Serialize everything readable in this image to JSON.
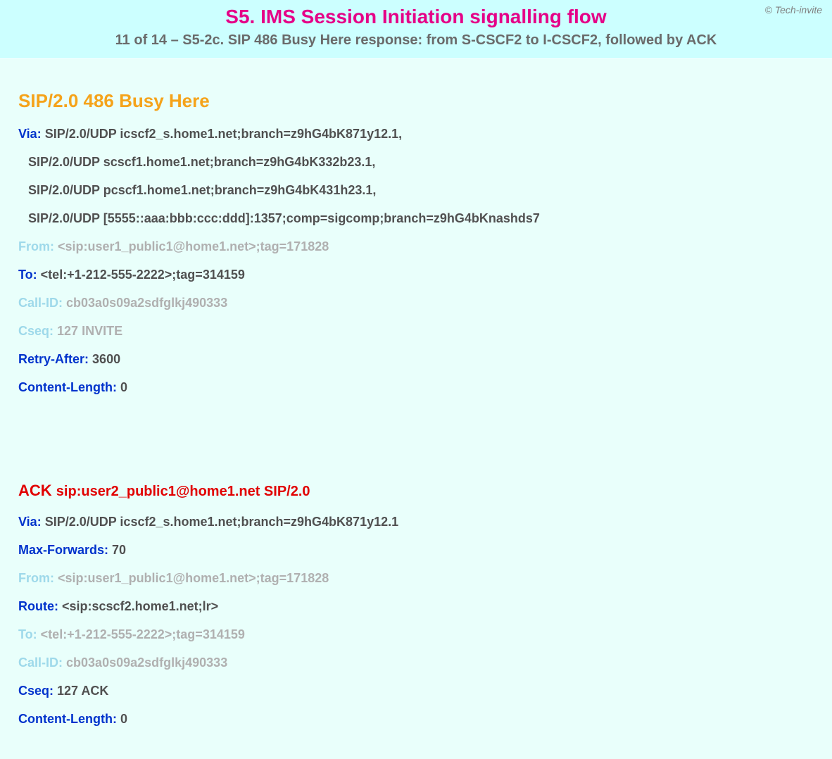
{
  "header": {
    "attribution": "© Tech-invite",
    "title": "S5. IMS Session Initiation signalling flow",
    "subtitle": "11 of 14 – S5-2c. SIP 486 Busy Here response: from S-CSCF2 to I-CSCF2, followed by ACK"
  },
  "response": {
    "title": "SIP/2.0 486 Busy Here",
    "via": {
      "label": "Via",
      "line1": "SIP/2.0/UDP icscf2_s.home1.net;branch=z9hG4bK871y12.1,",
      "line2": "SIP/2.0/UDP scscf1.home1.net;branch=z9hG4bK332b23.1,",
      "line3": "SIP/2.0/UDP pcscf1.home1.net;branch=z9hG4bK431h23.1,",
      "line4": "SIP/2.0/UDP [5555::aaa:bbb:ccc:ddd]:1357;comp=sigcomp;branch=z9hG4bKnashds7"
    },
    "from": {
      "label": "From",
      "value": "<sip:user1_public1@home1.net>;tag=171828"
    },
    "to": {
      "label": "To",
      "value": "<tel:+1-212-555-2222>;tag=314159"
    },
    "call_id": {
      "label": "Call-ID",
      "value": "cb03a0s09a2sdfglkj490333"
    },
    "cseq": {
      "label": "Cseq",
      "value": "127 INVITE"
    },
    "retry_after": {
      "label": "Retry-After",
      "value": "3600"
    },
    "content_length": {
      "label": "Content-Length",
      "value": "0"
    }
  },
  "ack": {
    "method": "ACK",
    "request_uri": "sip:user2_public1@home1.net SIP/2.0",
    "via": {
      "label": "Via",
      "value": "SIP/2.0/UDP icscf2_s.home1.net;branch=z9hG4bK871y12.1"
    },
    "max_forwards": {
      "label": "Max-Forwards",
      "value": "70"
    },
    "from": {
      "label": "From",
      "value": "<sip:user1_public1@home1.net>;tag=171828"
    },
    "route": {
      "label": "Route",
      "value": "<sip:scscf2.home1.net;lr>"
    },
    "to": {
      "label": "To",
      "value": "<tel:+1-212-555-2222>;tag=314159"
    },
    "call_id": {
      "label": "Call-ID",
      "value": "cb03a0s09a2sdfglkj490333"
    },
    "cseq": {
      "label": "Cseq",
      "value": "127 ACK"
    },
    "content_length": {
      "label": "Content-Length",
      "value": "0"
    }
  }
}
